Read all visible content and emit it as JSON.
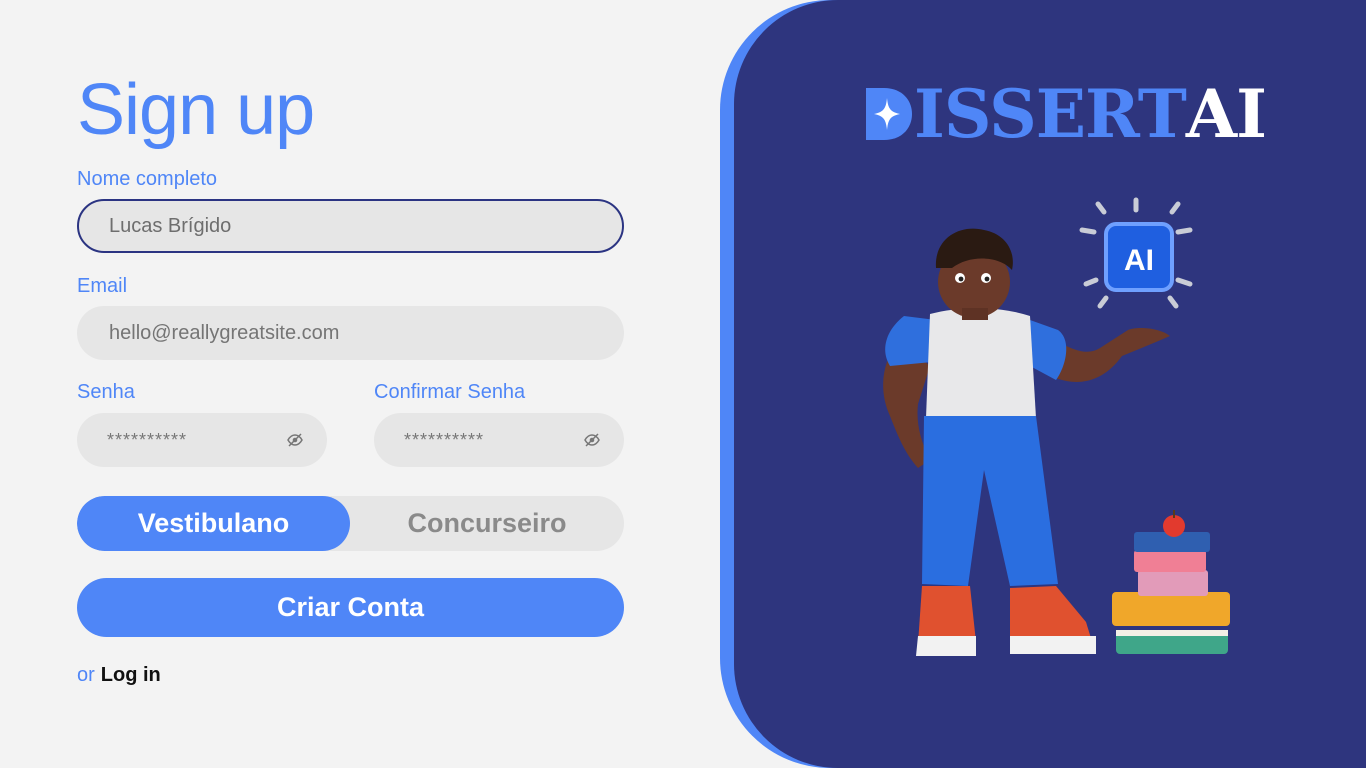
{
  "page_title": "Sign up",
  "form": {
    "full_name": {
      "label": "Nome completo",
      "value": "Lucas Brígido"
    },
    "email": {
      "label": "Email",
      "placeholder": "hello@reallygreatsite.com"
    },
    "password": {
      "label": "Senha",
      "mask": "**********"
    },
    "confirm_password": {
      "label": "Confirmar Senha",
      "mask": "**********"
    },
    "profile_toggle": {
      "options": [
        "Vestibulano",
        "Concurseiro"
      ],
      "selected": "Vestibulano"
    },
    "submit_label": "Criar Conta",
    "alt_prefix": "or",
    "login_link": "Log in"
  },
  "brand": {
    "logo_part1": "ISSERT",
    "logo_part2": "AI",
    "ai_badge": "AI"
  },
  "colors": {
    "accent": "#4f86f7",
    "panel": "#2e357e",
    "background": "#f3f3f3",
    "field": "#e6e6e6"
  },
  "icons": {
    "password_visibility": "eye-off-icon",
    "logo_mark": "sparkle-d-icon"
  }
}
